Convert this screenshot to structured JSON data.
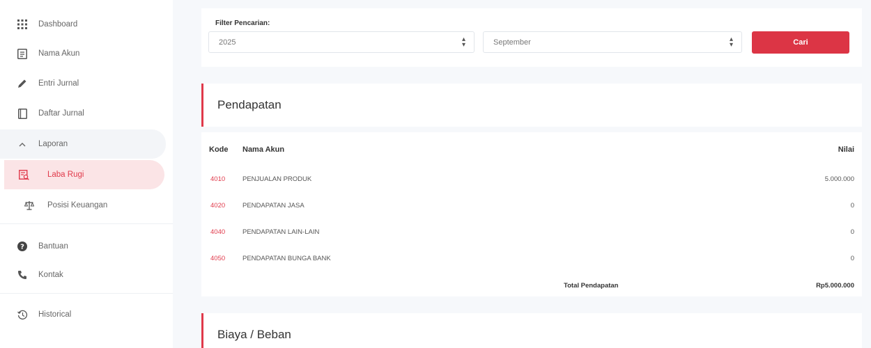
{
  "sidebar": {
    "items": [
      {
        "label": "Dashboard",
        "icon": "grid-icon"
      },
      {
        "label": "Nama Akun",
        "icon": "list-icon"
      },
      {
        "label": "Entri Jurnal",
        "icon": "pencil-icon"
      },
      {
        "label": "Daftar Jurnal",
        "icon": "book-icon"
      },
      {
        "label": "Laporan",
        "icon": "chevron-up-icon"
      },
      {
        "label": "Laba Rugi",
        "icon": "report-icon"
      },
      {
        "label": "Posisi Keuangan",
        "icon": "scale-icon"
      },
      {
        "label": "Bantuan",
        "icon": "question-icon"
      },
      {
        "label": "Kontak",
        "icon": "phone-icon"
      },
      {
        "label": "Historical",
        "icon": "history-icon"
      }
    ]
  },
  "filter": {
    "label": "Filter Pencarian:",
    "year": "2025",
    "month": "September",
    "button_label": "Cari"
  },
  "pendapatan": {
    "title": "Pendapatan",
    "headers": {
      "code": "Kode",
      "name": "Nama Akun",
      "value": "Nilai"
    },
    "rows": [
      {
        "code": "4010",
        "name": "PENJUALAN PRODUK",
        "value": "5.000.000"
      },
      {
        "code": "4020",
        "name": "PENDAPATAN JASA",
        "value": "0"
      },
      {
        "code": "4040",
        "name": "PENDAPATAN LAIN-LAIN",
        "value": "0"
      },
      {
        "code": "4050",
        "name": "PENDAPATAN BUNGA BANK",
        "value": "0"
      }
    ],
    "total_label": "Total Pendapatan",
    "total_value": "Rp5.000.000"
  },
  "biaya": {
    "title": "Biaya / Beban"
  },
  "colors": {
    "accent": "#dc3545",
    "active_bg": "#fbe4e6",
    "background": "#f6f8fb"
  }
}
